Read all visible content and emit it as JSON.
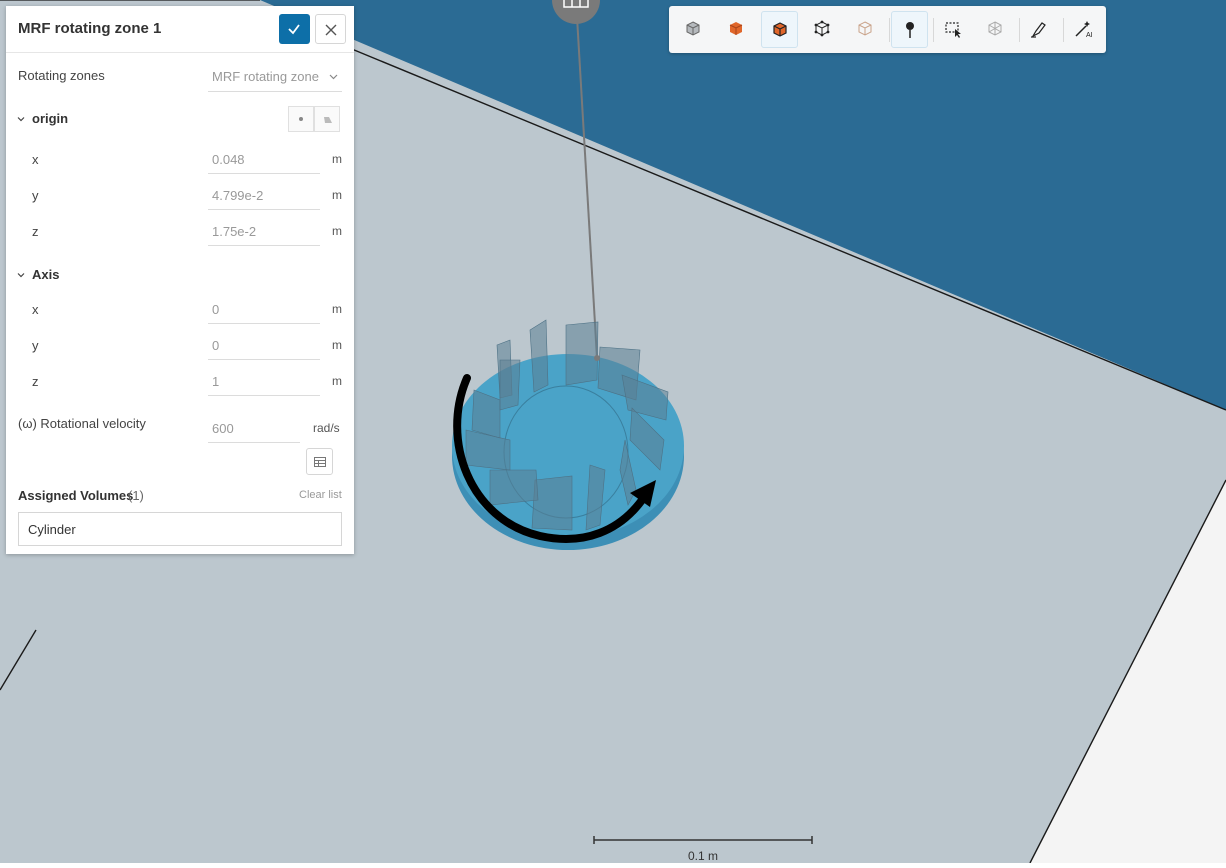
{
  "panel": {
    "title": "MRF rotating zone 1",
    "rotating_zones": {
      "label": "Rotating zones",
      "value": "MRF rotating zone"
    },
    "origin": {
      "label": "origin",
      "x": {
        "label": "x",
        "value": "0.048",
        "unit": "m"
      },
      "y": {
        "label": "y",
        "value": "4.799e-2",
        "unit": "m"
      },
      "z": {
        "label": "z",
        "value": "1.75e-2",
        "unit": "m"
      }
    },
    "axis": {
      "label": "Axis",
      "x": {
        "label": "x",
        "value": "0",
        "unit": "m"
      },
      "y": {
        "label": "y",
        "value": "0",
        "unit": "m"
      },
      "z": {
        "label": "z",
        "value": "1",
        "unit": "m"
      }
    },
    "rotational_velocity": {
      "label": "(ω) Rotational velocity",
      "value": "600",
      "unit": "rad/s"
    },
    "assigned_volumes": {
      "label": "Assigned Volumes",
      "count": "(1)",
      "clear_label": "Clear list",
      "items": [
        "Cylinder"
      ]
    }
  },
  "toolbar": {
    "buttons": [
      {
        "icon": "cube-view-icon",
        "active": false
      },
      {
        "icon": "solid-cube-icon",
        "active": false
      },
      {
        "icon": "solid-edges-cube-icon",
        "active": true
      },
      {
        "icon": "wireframe-cube-icon",
        "active": false
      },
      {
        "icon": "transparent-cube-icon",
        "active": false
      },
      {
        "icon": "point-probe-icon",
        "active": true
      },
      {
        "icon": "box-select-icon",
        "active": false
      },
      {
        "icon": "mesh-icon",
        "active": false
      },
      {
        "icon": "paint-select-icon",
        "active": false
      },
      {
        "icon": "ai-wand-icon",
        "active": false
      }
    ]
  },
  "viewport": {
    "scale_bar_label": "0.1 m"
  },
  "colors": {
    "background": "#2b6b94",
    "plane": "#bcc7ce",
    "cylinder": "#4aa3c8",
    "accent": "#0d6fa8",
    "arrow": "#000000"
  }
}
